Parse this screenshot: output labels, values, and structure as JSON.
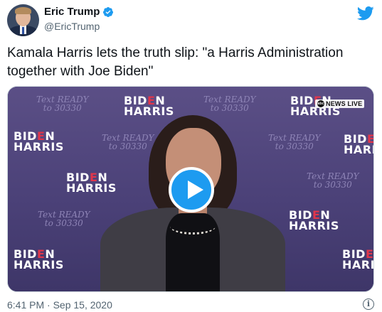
{
  "author": {
    "display_name": "Eric Trump",
    "handle": "@EricTrump",
    "verified": true,
    "avatar_icon": "profile-photo",
    "brand_icon": "twitter-bird-icon"
  },
  "tweet": {
    "text": "Kamala Harris lets the truth slip: \"a Harris Administration together with Joe Biden\"",
    "timestamp": "6:41 PM · Sep 15, 2020"
  },
  "media": {
    "type": "video",
    "play_icon": "play-icon",
    "channel_label": "NEWS LIVE",
    "backdrop": {
      "biden_text": "BIDEN",
      "harris_text": "HARRIS",
      "text_ready": "Text READY",
      "text_number": "to 30330"
    }
  },
  "colors": {
    "accent": "#1d9bf0",
    "text": "#0f1419",
    "secondary": "#536471",
    "backdrop": "#4b4178",
    "logo_red": "#e0364b"
  },
  "icons": {
    "verified": "verified-badge-icon",
    "info": "info-icon"
  }
}
